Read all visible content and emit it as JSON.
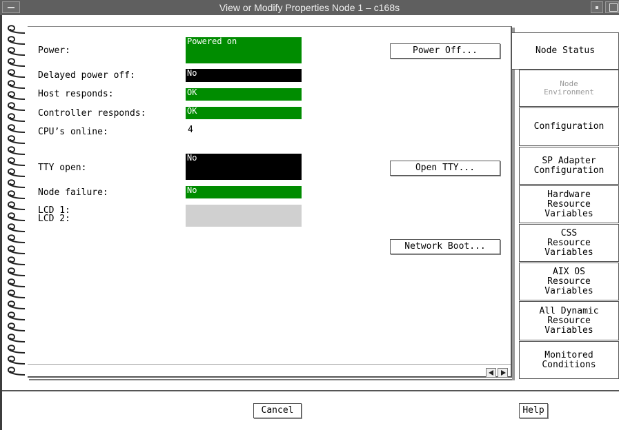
{
  "window": {
    "title": "View or Modify Properties Node 1 – c168s"
  },
  "fields": {
    "power": {
      "label": "Power:",
      "value": "Powered on"
    },
    "delayed_power_off": {
      "label": "Delayed power off:",
      "value": "No"
    },
    "host_responds": {
      "label": "Host responds:",
      "value": "OK"
    },
    "controller_responds": {
      "label": "Controller responds:",
      "value": "OK"
    },
    "cpus_online": {
      "label": "CPU’s online:",
      "value": "4"
    },
    "tty_open": {
      "label": "TTY open:",
      "value": "No"
    },
    "node_failure": {
      "label": "Node failure:",
      "value": "No"
    },
    "lcd1": {
      "label": "LCD 1:",
      "value": ""
    },
    "lcd2": {
      "label": "LCD 2:",
      "value": ""
    }
  },
  "buttons": {
    "power_off": "Power Off...",
    "open_tty": "Open TTY...",
    "network_boot": "Network Boot...",
    "cancel": "Cancel",
    "help": "Help"
  },
  "tabs": [
    {
      "label": "Node Status",
      "state": "active"
    },
    {
      "label": "Node\nEnvironment",
      "state": "disabled"
    },
    {
      "label": "Configuration",
      "state": "normal"
    },
    {
      "label": "SP Adapter\nConfiguration",
      "state": "normal"
    },
    {
      "label": "Hardware\nResource\nVariables",
      "state": "normal"
    },
    {
      "label": "CSS\nResource\nVariables",
      "state": "normal"
    },
    {
      "label": "AIX OS\nResource\nVariables",
      "state": "normal"
    },
    {
      "label": "All Dynamic\nResource\nVariables",
      "state": "normal"
    },
    {
      "label": "Monitored\nConditions",
      "state": "normal"
    }
  ],
  "colors": {
    "ok_green": "#008c00",
    "alert_black": "#000000",
    "empty_gray": "#d0d0d0",
    "titlebar": "#5f5f5f"
  }
}
